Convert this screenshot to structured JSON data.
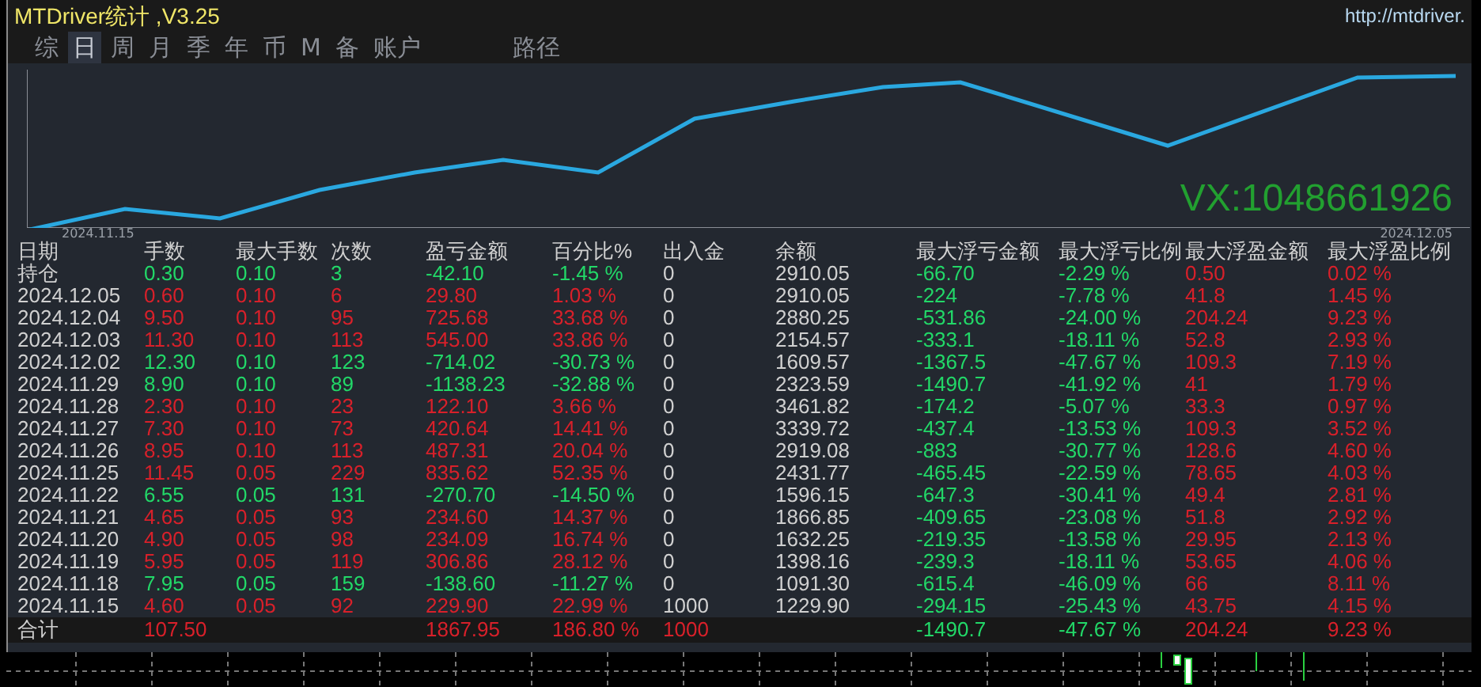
{
  "window": {
    "title": "MTDriver统计 ,V3.25",
    "link": "http://mtdriver."
  },
  "tabs": [
    {
      "label": "综",
      "selected": false
    },
    {
      "label": "日",
      "selected": true
    },
    {
      "label": "周",
      "selected": false
    },
    {
      "label": "月",
      "selected": false
    },
    {
      "label": "季",
      "selected": false
    },
    {
      "label": "年",
      "selected": false
    },
    {
      "label": "币",
      "selected": false
    },
    {
      "label": "M",
      "selected": false
    },
    {
      "label": "备",
      "selected": false
    },
    {
      "label": "账户",
      "selected": false
    }
  ],
  "path_tab": {
    "label": "路径",
    "selected": false
  },
  "chart": {
    "start_label": "2024.11.15",
    "end_label": "2024.12.05",
    "watermark_text": "VX:1048661926"
  },
  "table": {
    "columns": [
      "日期",
      "手数",
      "最大手数",
      "次数",
      "盈亏金额",
      "百分比%",
      "出入金",
      "余额",
      "最大浮亏金额",
      "最大浮亏比例",
      "最大浮盈金额",
      "最大浮盈比例"
    ],
    "rows": [
      {
        "kind": "day",
        "loss": true,
        "cells": [
          "持仓",
          "0.30",
          "0.10",
          "3",
          "-42.10",
          "-1.45 %",
          "0",
          "2910.05",
          "-66.70",
          "-2.29 %",
          "0.50",
          "0.02 %"
        ]
      },
      {
        "kind": "day",
        "loss": false,
        "cells": [
          "2024.12.05",
          "0.60",
          "0.10",
          "6",
          "29.80",
          "1.03 %",
          "0",
          "2910.05",
          "-224",
          "-7.78 %",
          "41.8",
          "1.45 %"
        ]
      },
      {
        "kind": "day",
        "loss": false,
        "cells": [
          "2024.12.04",
          "9.50",
          "0.10",
          "95",
          "725.68",
          "33.68 %",
          "0",
          "2880.25",
          "-531.86",
          "-24.00 %",
          "204.24",
          "9.23 %"
        ]
      },
      {
        "kind": "day",
        "loss": false,
        "cells": [
          "2024.12.03",
          "11.30",
          "0.10",
          "113",
          "545.00",
          "33.86 %",
          "0",
          "2154.57",
          "-333.1",
          "-18.11 %",
          "52.8",
          "2.93 %"
        ]
      },
      {
        "kind": "day",
        "loss": true,
        "cells": [
          "2024.12.02",
          "12.30",
          "0.10",
          "123",
          "-714.02",
          "-30.73 %",
          "0",
          "1609.57",
          "-1367.5",
          "-47.67 %",
          "109.3",
          "7.19 %"
        ]
      },
      {
        "kind": "day",
        "loss": true,
        "cells": [
          "2024.11.29",
          "8.90",
          "0.10",
          "89",
          "-1138.23",
          "-32.88 %",
          "0",
          "2323.59",
          "-1490.7",
          "-41.92 %",
          "41",
          "1.79 %"
        ]
      },
      {
        "kind": "day",
        "loss": false,
        "cells": [
          "2024.11.28",
          "2.30",
          "0.10",
          "23",
          "122.10",
          "3.66 %",
          "0",
          "3461.82",
          "-174.2",
          "-5.07 %",
          "33.3",
          "0.97 %"
        ]
      },
      {
        "kind": "day",
        "loss": false,
        "cells": [
          "2024.11.27",
          "7.30",
          "0.10",
          "73",
          "420.64",
          "14.41 %",
          "0",
          "3339.72",
          "-437.4",
          "-13.53 %",
          "109.3",
          "3.52 %"
        ]
      },
      {
        "kind": "day",
        "loss": false,
        "cells": [
          "2024.11.26",
          "8.95",
          "0.10",
          "113",
          "487.31",
          "20.04 %",
          "0",
          "2919.08",
          "-883",
          "-30.77 %",
          "128.6",
          "4.60 %"
        ]
      },
      {
        "kind": "day",
        "loss": false,
        "cells": [
          "2024.11.25",
          "11.45",
          "0.05",
          "229",
          "835.62",
          "52.35 %",
          "0",
          "2431.77",
          "-465.45",
          "-22.59 %",
          "78.65",
          "4.03 %"
        ]
      },
      {
        "kind": "day",
        "loss": true,
        "cells": [
          "2024.11.22",
          "6.55",
          "0.05",
          "131",
          "-270.70",
          "-14.50 %",
          "0",
          "1596.15",
          "-647.3",
          "-30.41 %",
          "49.4",
          "2.81 %"
        ]
      },
      {
        "kind": "day",
        "loss": false,
        "cells": [
          "2024.11.21",
          "4.65",
          "0.05",
          "93",
          "234.60",
          "14.37 %",
          "0",
          "1866.85",
          "-409.65",
          "-23.08 %",
          "51.8",
          "2.92 %"
        ]
      },
      {
        "kind": "day",
        "loss": false,
        "cells": [
          "2024.11.20",
          "4.90",
          "0.05",
          "98",
          "234.09",
          "16.74 %",
          "0",
          "1632.25",
          "-219.35",
          "-13.58 %",
          "29.95",
          "2.13 %"
        ]
      },
      {
        "kind": "day",
        "loss": false,
        "cells": [
          "2024.11.19",
          "5.95",
          "0.05",
          "119",
          "306.86",
          "28.12 %",
          "0",
          "1398.16",
          "-239.3",
          "-18.11 %",
          "53.65",
          "4.06 %"
        ]
      },
      {
        "kind": "day",
        "loss": true,
        "cells": [
          "2024.11.18",
          "7.95",
          "0.05",
          "159",
          "-138.60",
          "-11.27 %",
          "0",
          "1091.30",
          "-615.4",
          "-46.09 %",
          "66",
          "8.11 %"
        ]
      },
      {
        "kind": "day",
        "loss": false,
        "cells": [
          "2024.11.15",
          "4.60",
          "0.05",
          "92",
          "229.90",
          "22.99 %",
          "1000",
          "1229.90",
          "-294.15",
          "-25.43 %",
          "43.75",
          "4.15 %"
        ]
      },
      {
        "kind": "total",
        "loss": false,
        "cells": [
          "合计",
          "107.50",
          null,
          null,
          "1867.95",
          "186.80 %",
          "1000",
          null,
          "-1490.7",
          "-47.67 %",
          "204.24",
          "9.23 %"
        ]
      }
    ]
  }
}
